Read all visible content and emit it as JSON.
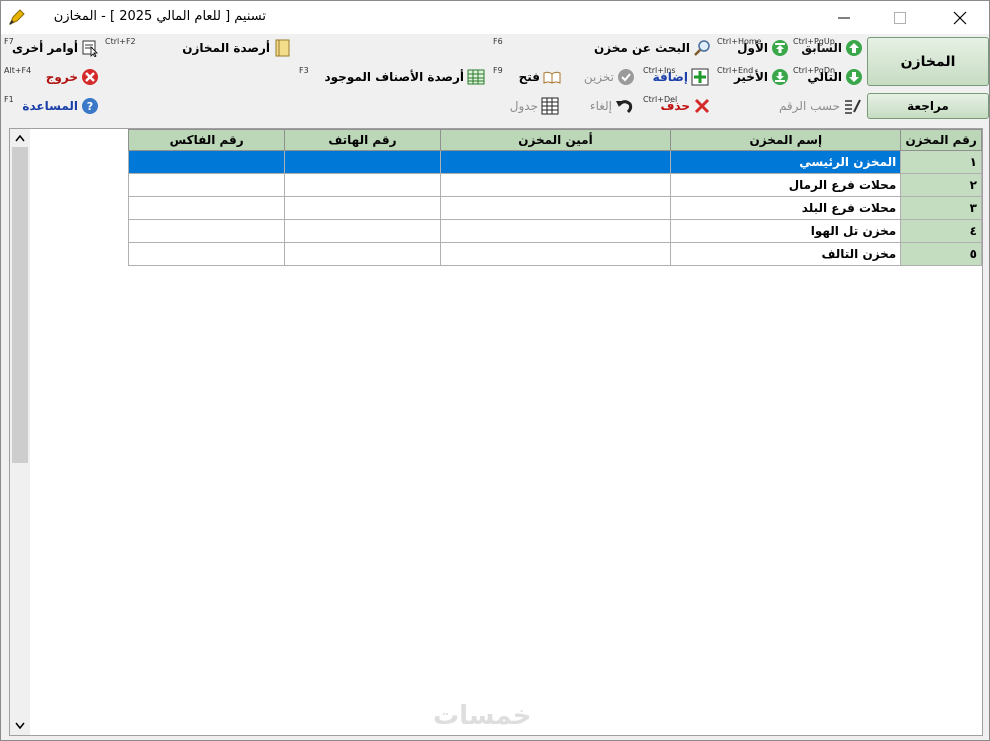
{
  "window": {
    "title": "تسنيم  [ للعام المالي 2025 ]  - المخازن"
  },
  "toolbar": {
    "row1": {
      "prev_label": "السابق",
      "prev_shortcut": "Ctrl+PgUp",
      "first_label": "الأول",
      "first_shortcut": "Ctrl+Home",
      "search_label": "البحث عن مخزن",
      "search_shortcut": "F6",
      "balances_label": "أرصدة المخازن",
      "balances_shortcut": "Ctrl+F2",
      "other_label": "أوامر أخرى",
      "other_shortcut": "F7"
    },
    "row2": {
      "next_label": "التالي",
      "next_shortcut": "Ctrl+PgDn",
      "last_label": "الأخير",
      "last_shortcut": "Ctrl+End",
      "add_label": "إضافة",
      "add_shortcut": "Ctrl+Ins",
      "save_label": "تخزين",
      "open_label": "فتح",
      "open_shortcut": "F9",
      "items_balance_label": "أرصدة الأصناف الموجود",
      "items_balance_shortcut": "F3",
      "exit_label": "خروج",
      "exit_shortcut": "Alt+F4"
    },
    "row3": {
      "by_number_label": "حسب الرقم",
      "delete_label": "حذف",
      "delete_shortcut": "Ctrl+Del",
      "cancel_label": "إلغاء",
      "table_label": "جدول",
      "help_label": "المساعدة",
      "help_shortcut": "F1"
    }
  },
  "side_buttons": {
    "stores_label": "المخازن",
    "review_label": "مراجعة"
  },
  "grid": {
    "columns": [
      "رقم المخزن",
      "إسم المخزن",
      "أمين المخزن",
      "رقم الهاتف",
      "رقم الفاكس"
    ],
    "rows": [
      {
        "num": "١",
        "name": "المخزن الرئيسي",
        "keeper": "",
        "phone": "",
        "fax": ""
      },
      {
        "num": "٢",
        "name": "محلات فرع الرمال",
        "keeper": "",
        "phone": "",
        "fax": ""
      },
      {
        "num": "٣",
        "name": "محلات فرع البلد",
        "keeper": "",
        "phone": "",
        "fax": ""
      },
      {
        "num": "٤",
        "name": "مخزن تل الهوا",
        "keeper": "",
        "phone": "",
        "fax": ""
      },
      {
        "num": "٥",
        "name": "مخزن التالف",
        "keeper": "",
        "phone": "",
        "fax": ""
      }
    ]
  },
  "watermark": "خمسات"
}
